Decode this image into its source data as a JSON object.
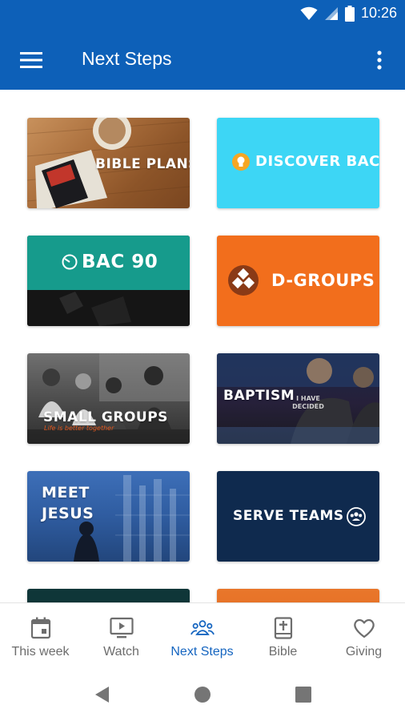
{
  "status_bar": {
    "time": "10:26"
  },
  "app_bar": {
    "title": "Next Steps"
  },
  "tiles": [
    {
      "label": "BIBLE PLANS"
    },
    {
      "label": "DISCOVER BAC"
    },
    {
      "label": "BAC 90"
    },
    {
      "label": "D-GROUPS"
    },
    {
      "label": "SMALL GROUPS",
      "sublabel": "Life is better together"
    },
    {
      "label": "BAPTISM",
      "shirt_text": "I HAVE DECIDED"
    },
    {
      "label_line1": "MEET",
      "label_line2": "JESUS"
    },
    {
      "label": "SERVE TEAMS"
    }
  ],
  "bottom_nav": {
    "items": [
      {
        "label": "This week",
        "icon": "calendar-icon"
      },
      {
        "label": "Watch",
        "icon": "play-screen-icon"
      },
      {
        "label": "Next Steps",
        "icon": "people-group-icon"
      },
      {
        "label": "Bible",
        "icon": "bible-icon"
      },
      {
        "label": "Giving",
        "icon": "heart-icon"
      }
    ],
    "active": "Next Steps"
  },
  "colors": {
    "brand_blue": "#0d60b8",
    "active_nav": "#1565c0",
    "discover_cyan": "#3dd6f5",
    "bac90_teal": "#169b8c",
    "dgroups_orange": "#f26e1c",
    "serve_navy": "#0f2a4e"
  }
}
